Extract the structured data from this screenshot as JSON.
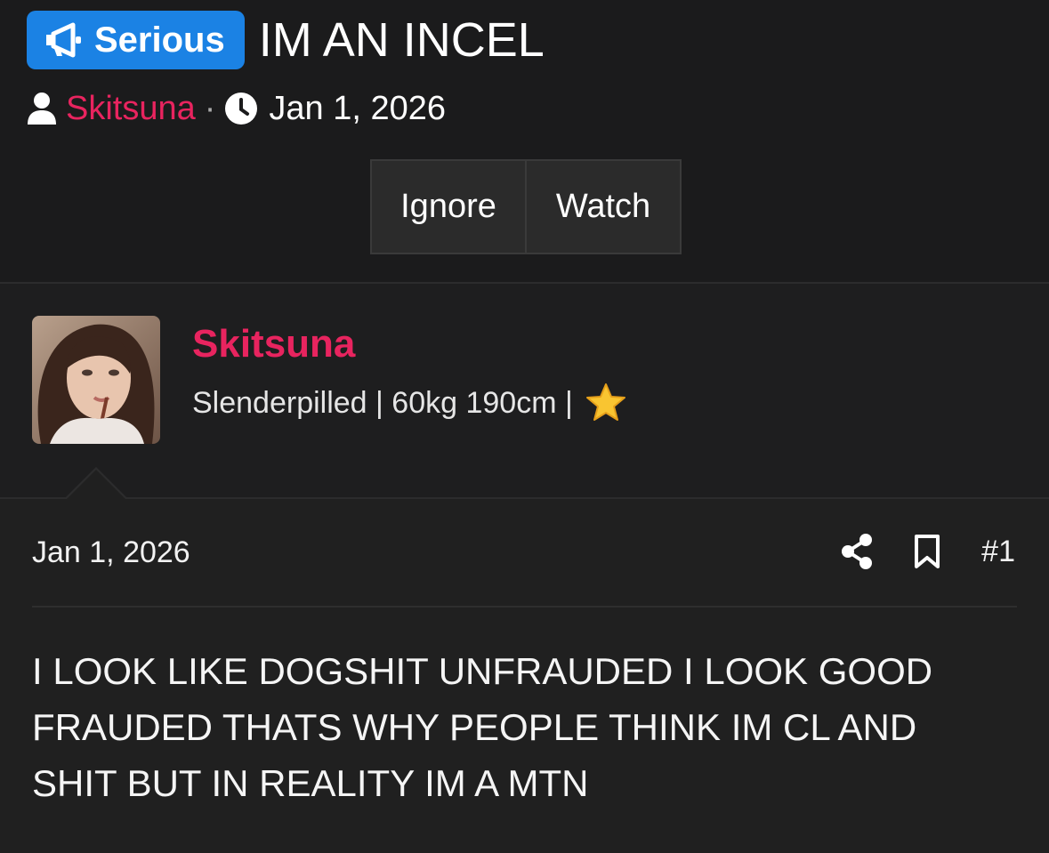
{
  "thread": {
    "prefix_label": "Serious",
    "title": "IM AN INCEL",
    "author": "Skitsuna",
    "date": "Jan 1, 2026"
  },
  "buttons": {
    "ignore_label": "Ignore",
    "watch_label": "Watch"
  },
  "user": {
    "name": "Skitsuna",
    "title": "Slenderpilled | 60kg 190cm |",
    "badge_icon": "star-icon"
  },
  "post": {
    "date": "Jan 1, 2026",
    "number": "#1",
    "body": "I LOOK LIKE DOGSHIT UNFRAUDED I LOOK GOOD FRAUDED THATS WHY PEOPLE THINK IM CL AND SHIT BUT IN REALITY IM A MTN"
  },
  "colors": {
    "prefix_bg": "#1b82e4",
    "username": "#e8245f",
    "background": "#1b1b1c"
  }
}
